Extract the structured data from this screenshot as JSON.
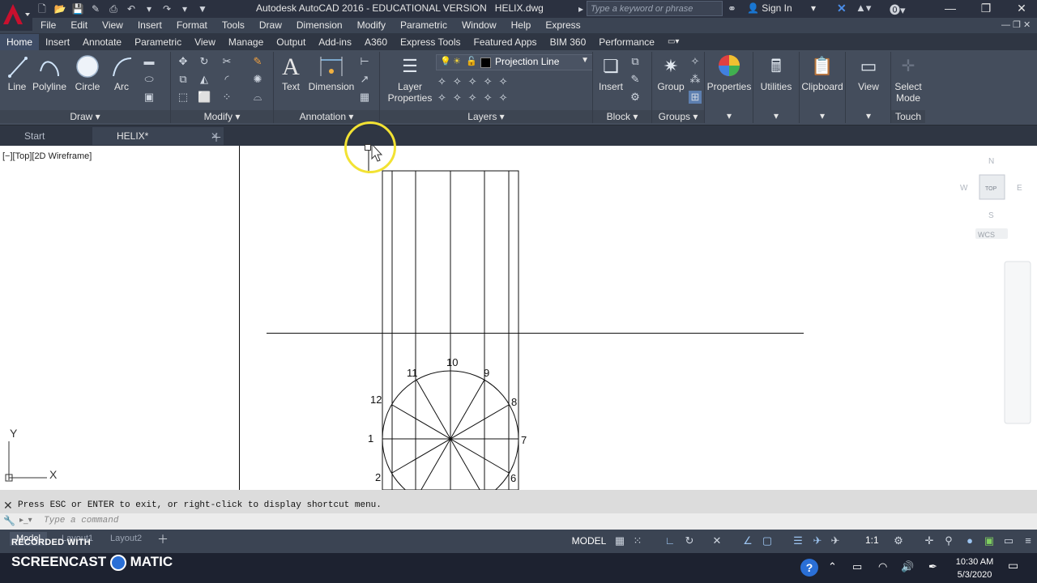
{
  "titlebar": {
    "app_title": "Autodesk AutoCAD 2016 - EDUCATIONAL VERSION",
    "file_name": "HELIX.dwg",
    "search_placeholder": "Type a keyword or phrase",
    "signin_label": "Sign In"
  },
  "menubar": {
    "items": [
      "File",
      "Edit",
      "View",
      "Insert",
      "Format",
      "Tools",
      "Draw",
      "Dimension",
      "Modify",
      "Parametric",
      "Window",
      "Help",
      "Express"
    ]
  },
  "ribbon_tabs": [
    "Home",
    "Insert",
    "Annotate",
    "Parametric",
    "View",
    "Manage",
    "Output",
    "Add-ins",
    "A360",
    "Express Tools",
    "Featured Apps",
    "BIM 360",
    "Performance"
  ],
  "ribbon": {
    "draw": {
      "line": "Line",
      "polyline": "Polyline",
      "circle": "Circle",
      "arc": "Arc",
      "panel": "Draw"
    },
    "modify": {
      "panel": "Modify"
    },
    "annotation": {
      "text": "Text",
      "dimension": "Dimension",
      "panel": "Annotation"
    },
    "layers": {
      "layer_properties_1": "Layer",
      "layer_properties_2": "Properties",
      "current_layer": "Projection Line",
      "panel": "Layers"
    },
    "block": {
      "insert": "Insert",
      "panel": "Block"
    },
    "groups": {
      "group": "Group",
      "panel": "Groups"
    },
    "properties": "Properties",
    "utilities": "Utilities",
    "clipboard": "Clipboard",
    "view": "View",
    "touch": {
      "select_mode_1": "Select",
      "select_mode_2": "Mode",
      "panel": "Touch"
    }
  },
  "file_tabs": {
    "start": "Start",
    "helix": "HELIX*"
  },
  "viewport": {
    "label": "[−][Top][2D Wireframe]",
    "viewcube": {
      "north": "N",
      "south": "S",
      "east": "E",
      "west": "W",
      "top": "TOP",
      "wcs": "WCS"
    },
    "ucs": {
      "x": "X",
      "y": "Y"
    },
    "point_labels": [
      "1",
      "2",
      "6",
      "7",
      "8",
      "9",
      "10",
      "11",
      "12"
    ]
  },
  "command": {
    "history": "Press ESC or ENTER to exit, or right-click to display shortcut menu.",
    "input_placeholder": "Type a command"
  },
  "layout_tabs": [
    "Model",
    "Layout1",
    "Layout2"
  ],
  "statusbar": {
    "model": "MODEL",
    "scale": "1:1"
  },
  "taskbar": {
    "time": "10:30 AM",
    "date": "5/3/2020"
  },
  "watermark": {
    "recorded": "RECORDED WITH",
    "brand_left": "SCREENCAST",
    "brand_right": "MATIC"
  },
  "colors": {
    "accent": "#3f4d66",
    "autocad_red": "#c8102e",
    "highlight_yellow": "#f2e233"
  }
}
